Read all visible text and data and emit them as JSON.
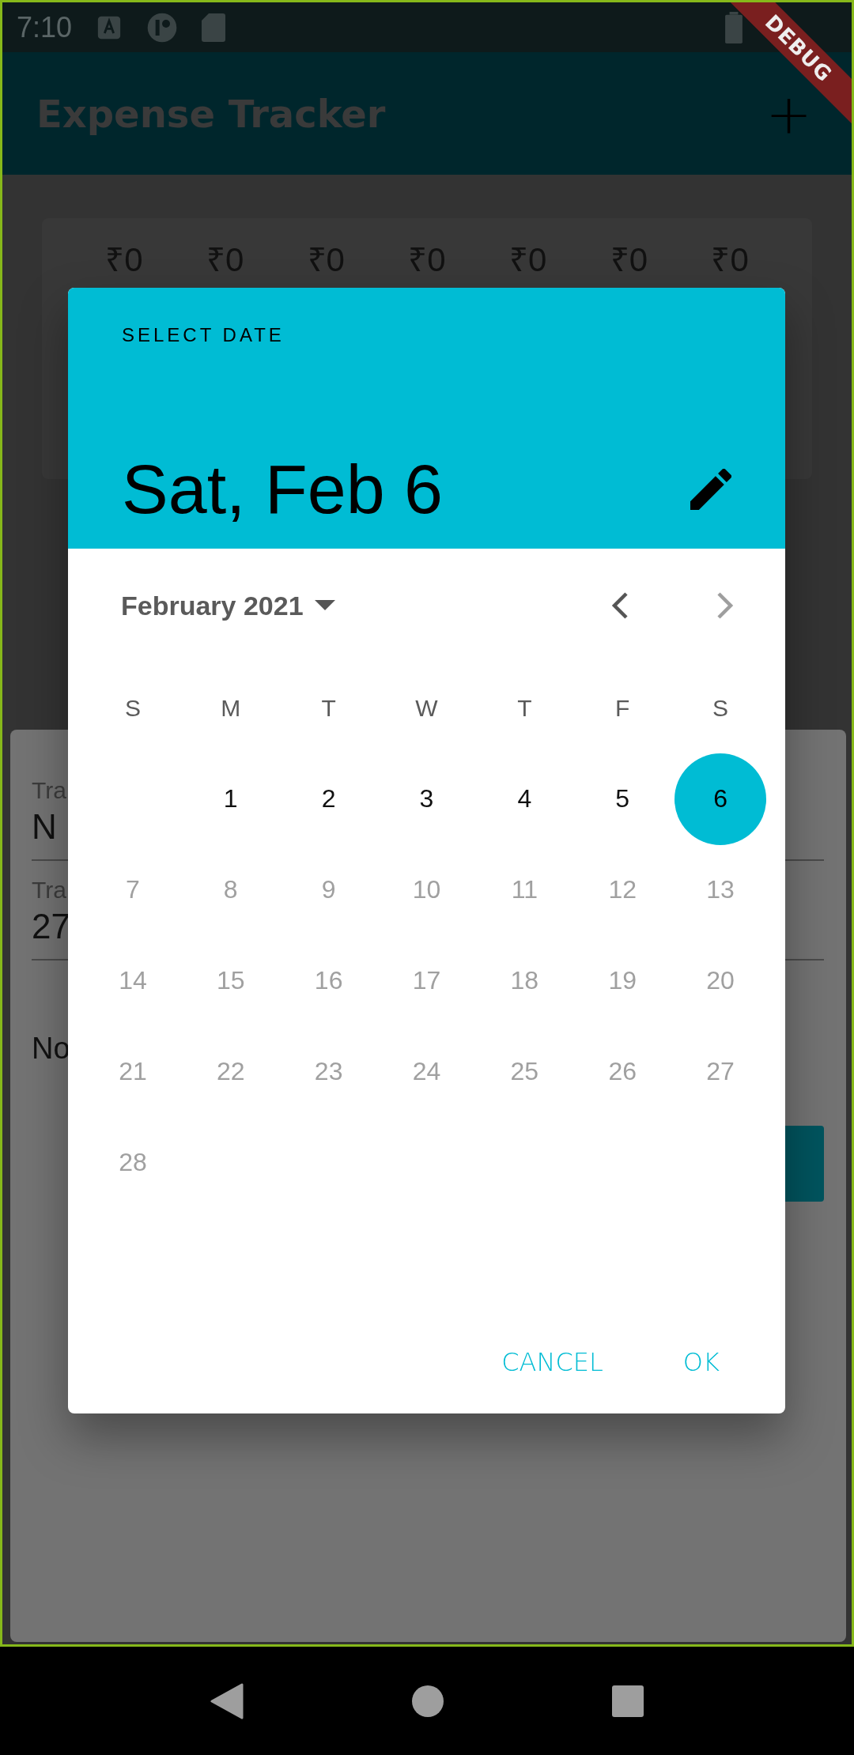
{
  "status_bar": {
    "time": "7:10"
  },
  "debug_banner": {
    "label": "DEBUG"
  },
  "app_bar": {
    "title": "Expense Tracker",
    "action": "+"
  },
  "chart_card": {
    "bar_labels": [
      "₹0",
      "₹0",
      "₹0",
      "₹0",
      "₹0",
      "₹0",
      "₹0"
    ]
  },
  "form": {
    "fields": [
      {
        "label": "Tra",
        "value": "N"
      },
      {
        "label": "Tra",
        "value": "27"
      }
    ],
    "date_text": "No"
  },
  "date_picker": {
    "heading": "SELECT DATE",
    "selected_date": "Sat, Feb 6",
    "month_label": "February 2021",
    "prev_disabled": false,
    "next_disabled": true,
    "weekdays": [
      "S",
      "M",
      "T",
      "W",
      "T",
      "F",
      "S"
    ],
    "weeks": [
      [
        {
          "day": "1",
          "selected": false,
          "disabled": false
        },
        {
          "day": "2",
          "selected": false,
          "disabled": false
        },
        {
          "day": "3",
          "selected": false,
          "disabled": false
        },
        {
          "day": "4",
          "selected": false,
          "disabled": false
        },
        {
          "day": "5",
          "selected": false,
          "disabled": false
        },
        {
          "day": "6",
          "selected": true,
          "disabled": false
        }
      ],
      [
        {
          "day": "7",
          "selected": false,
          "disabled": true
        },
        {
          "day": "8",
          "selected": false,
          "disabled": true
        },
        {
          "day": "9",
          "selected": false,
          "disabled": true
        },
        {
          "day": "10",
          "selected": false,
          "disabled": true
        },
        {
          "day": "11",
          "selected": false,
          "disabled": true
        },
        {
          "day": "12",
          "selected": false,
          "disabled": true
        },
        {
          "day": "13",
          "selected": false,
          "disabled": true
        }
      ],
      [
        {
          "day": "14",
          "selected": false,
          "disabled": true
        },
        {
          "day": "15",
          "selected": false,
          "disabled": true
        },
        {
          "day": "16",
          "selected": false,
          "disabled": true
        },
        {
          "day": "17",
          "selected": false,
          "disabled": true
        },
        {
          "day": "18",
          "selected": false,
          "disabled": true
        },
        {
          "day": "19",
          "selected": false,
          "disabled": true
        },
        {
          "day": "20",
          "selected": false,
          "disabled": true
        }
      ],
      [
        {
          "day": "21",
          "selected": false,
          "disabled": true
        },
        {
          "day": "22",
          "selected": false,
          "disabled": true
        },
        {
          "day": "23",
          "selected": false,
          "disabled": true
        },
        {
          "day": "24",
          "selected": false,
          "disabled": true
        },
        {
          "day": "25",
          "selected": false,
          "disabled": true
        },
        {
          "day": "26",
          "selected": false,
          "disabled": true
        },
        {
          "day": "27",
          "selected": false,
          "disabled": true
        }
      ],
      [
        {
          "day": "28",
          "selected": false,
          "disabled": true
        }
      ]
    ],
    "actions": [
      "CANCEL",
      "OK"
    ]
  }
}
